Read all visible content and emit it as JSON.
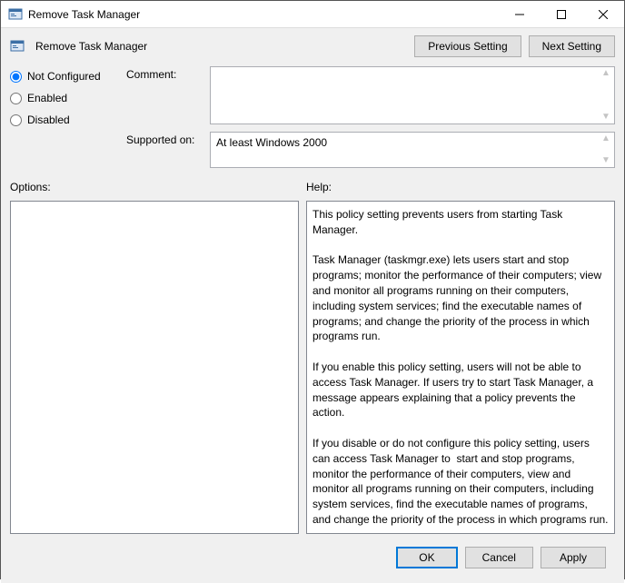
{
  "window": {
    "title": "Remove Task Manager"
  },
  "header": {
    "policy_name": "Remove Task Manager",
    "prev_button": "Previous Setting",
    "next_button": "Next Setting"
  },
  "state": {
    "options": {
      "not_configured": "Not Configured",
      "enabled": "Enabled",
      "disabled": "Disabled"
    },
    "selected": "not_configured"
  },
  "labels": {
    "comment": "Comment:",
    "supported_on": "Supported on:",
    "options": "Options:",
    "help": "Help:"
  },
  "fields": {
    "comment_value": "",
    "supported_value": "At least Windows 2000"
  },
  "help_text": "This policy setting prevents users from starting Task Manager.\n\nTask Manager (taskmgr.exe) lets users start and stop programs; monitor the performance of their computers; view and monitor all programs running on their computers, including system services; find the executable names of programs; and change the priority of the process in which programs run.\n\nIf you enable this policy setting, users will not be able to access Task Manager. If users try to start Task Manager, a message appears explaining that a policy prevents the action.\n\nIf you disable or do not configure this policy setting, users can access Task Manager to  start and stop programs, monitor the performance of their computers, view and monitor all programs running on their computers, including system services, find the executable names of programs, and change the priority of the process in which programs run.",
  "footer": {
    "ok": "OK",
    "cancel": "Cancel",
    "apply": "Apply"
  }
}
